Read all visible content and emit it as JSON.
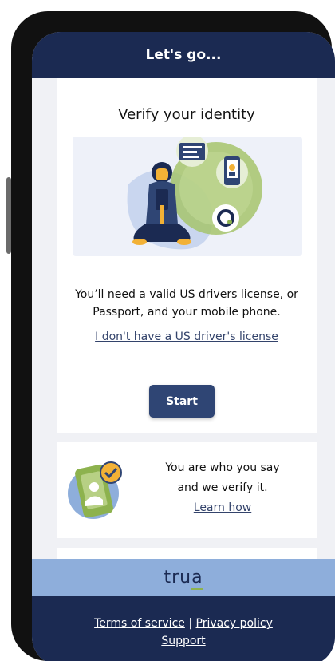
{
  "header": {
    "title": "Let's go..."
  },
  "verify_card": {
    "title": "Verify your identity",
    "description_line1": "You’ll need a valid US drivers license, or",
    "description_line2": "Passport, and your mobile phone.",
    "no_license_link": "I don't have a US driver's license",
    "start_button": "Start"
  },
  "who_card": {
    "line1": "You are who you say",
    "line2": "and we verify it.",
    "learn_link": "Learn how"
  },
  "brand": {
    "name": "tru",
    "mark": "a"
  },
  "footer": {
    "terms_link": "Terms of service",
    "separator": "|",
    "privacy_link": "Privacy policy",
    "support_link": "Support"
  },
  "colors": {
    "navy": "#1b2a52",
    "button": "#2f4574",
    "brand_bar": "#8eaedb",
    "accent_green": "#8db24e"
  }
}
